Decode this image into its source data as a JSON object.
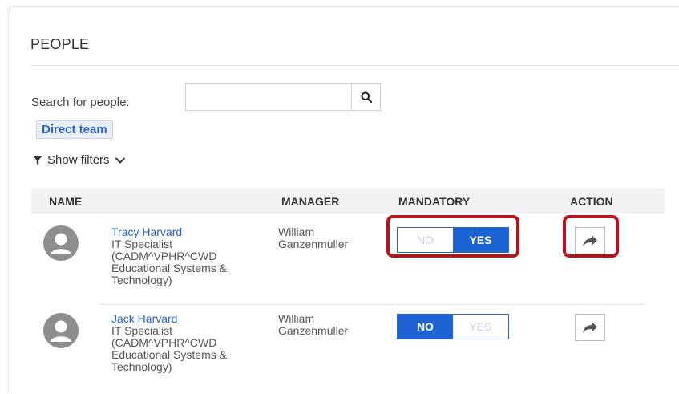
{
  "people": {
    "title": "PEOPLE",
    "search": {
      "label": "Search for people:",
      "value": "",
      "placeholder": ""
    },
    "chip_label": "Direct team",
    "filters_label": "Show filters",
    "table": {
      "columns": [
        "NAME",
        "MANAGER",
        "MANDATORY",
        "ACTION"
      ],
      "rows": [
        {
          "name": "Tracy Harvard",
          "title": "IT Specialist (CADM^VPHR^CWD Educational Systems & Technology)",
          "manager": "William Ganzenmuller",
          "mandatory": {
            "no_label": "NO",
            "yes_label": "YES",
            "selected": "YES"
          }
        },
        {
          "name": "Jack Harvard",
          "title": "IT Specialist (CADM^VPHR^CWD Educational Systems & Technology)",
          "manager": "William Ganzenmuller",
          "mandatory": {
            "no_label": "NO",
            "yes_label": "YES",
            "selected": "NO"
          }
        }
      ]
    }
  },
  "colors": {
    "accent": "#1e63d3",
    "link": "#2a64c5",
    "highlight": "#b8121b"
  },
  "icons": [
    "search-icon",
    "filter-icon",
    "chevron-down-icon",
    "user-avatar-icon",
    "share-arrow-icon"
  ]
}
